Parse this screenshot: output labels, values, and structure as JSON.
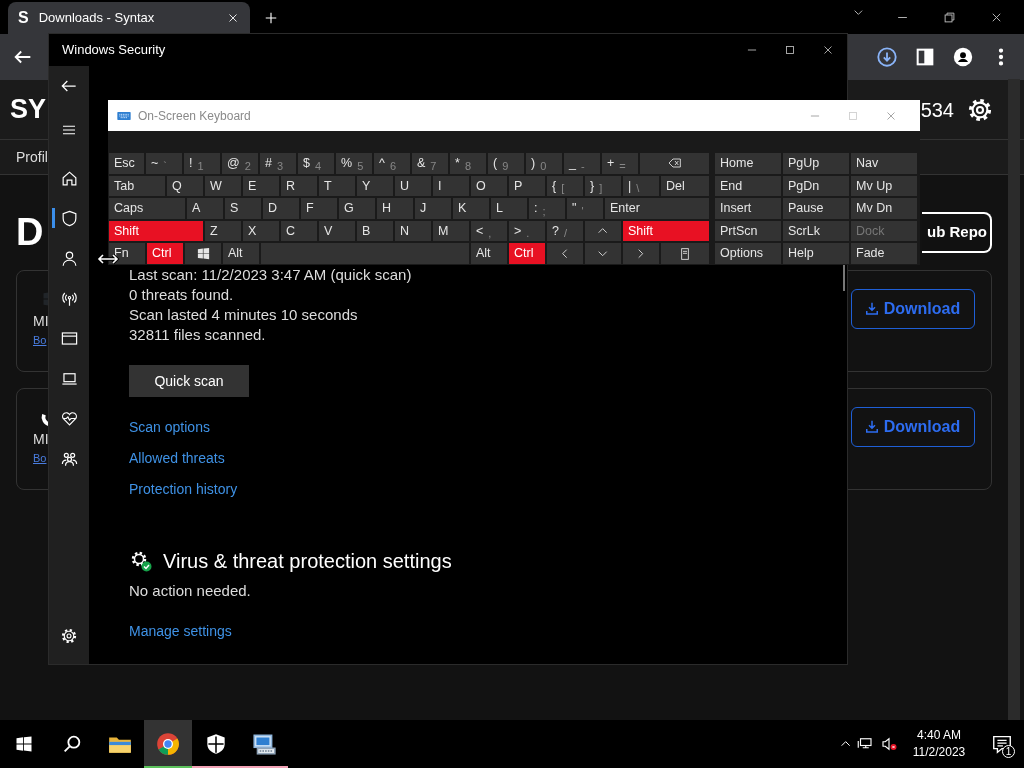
{
  "browser": {
    "tab": {
      "favicon": "S",
      "title": "Downloads - Syntax"
    },
    "page": {
      "brand": "SY",
      "star_count": "534",
      "nav_link": "Profil",
      "heading": "D",
      "repo_button": "ub Repo",
      "cards": [
        {
          "kind": "windows",
          "name": "MI",
          "link": "Bo",
          "button": "Download"
        },
        {
          "kind": "ring",
          "name": "MI",
          "link": "Bo",
          "button": "Download"
        }
      ]
    }
  },
  "security": {
    "title": "Windows Security",
    "nav": [
      {
        "kind": "home",
        "selected": false
      },
      {
        "kind": "shield",
        "selected": true
      },
      {
        "kind": "person",
        "selected": false
      },
      {
        "kind": "wireless",
        "selected": false
      },
      {
        "kind": "window",
        "selected": false
      },
      {
        "kind": "laptop",
        "selected": false
      },
      {
        "kind": "heart",
        "selected": false
      },
      {
        "kind": "family",
        "selected": false
      }
    ],
    "scan_info": [
      "Last scan: 11/2/2023 3:47 AM (quick scan)",
      "0 threats found.",
      "Scan lasted 4 minutes 10 seconds",
      "32811 files scanned."
    ],
    "scan_button": "Quick scan",
    "links": [
      "Scan options",
      "Allowed threats",
      "Protection history"
    ],
    "settings": {
      "heading": "Virus & threat protection settings",
      "status": "No action needed.",
      "link": "Manage settings"
    }
  },
  "keyboard": {
    "title": "On-Screen Keyboard",
    "rows": [
      {
        "keys": [
          {
            "kind": "key",
            "label": "Esc",
            "pressed": false
          },
          {
            "kind": "key",
            "label": "~",
            "sub": "`",
            "pressed": false
          },
          {
            "kind": "key",
            "label": "!",
            "sub": "1",
            "pressed": false
          },
          {
            "kind": "key",
            "label": "@",
            "sub": "2",
            "pressed": false
          },
          {
            "kind": "key",
            "label": "#",
            "sub": "3",
            "pressed": false
          },
          {
            "kind": "key",
            "label": "$",
            "sub": "4",
            "pressed": false
          },
          {
            "kind": "key",
            "label": "%",
            "sub": "5",
            "pressed": false
          },
          {
            "kind": "key",
            "label": "^",
            "sub": "6",
            "pressed": false
          },
          {
            "kind": "key",
            "label": "&",
            "sub": "7",
            "pressed": false
          },
          {
            "kind": "key",
            "label": "*",
            "sub": "8",
            "pressed": false
          },
          {
            "kind": "key",
            "label": "(",
            "sub": "9",
            "pressed": false
          },
          {
            "kind": "key",
            "label": ")",
            "sub": "0",
            "pressed": false
          },
          {
            "kind": "key",
            "label": "_",
            "sub": "-",
            "pressed": false
          },
          {
            "kind": "key",
            "label": "+",
            "sub": "=",
            "pressed": false
          },
          {
            "kind": "backspace",
            "pressed": false
          }
        ]
      },
      {
        "keys": [
          {
            "kind": "key",
            "label": "Tab",
            "pressed": false
          },
          {
            "kind": "key",
            "label": "Q",
            "pressed": false
          },
          {
            "kind": "key",
            "label": "W",
            "pressed": false
          },
          {
            "kind": "key",
            "label": "E",
            "pressed": false
          },
          {
            "kind": "key",
            "label": "R",
            "pressed": false
          },
          {
            "kind": "key",
            "label": "T",
            "pressed": false
          },
          {
            "kind": "key",
            "label": "Y",
            "pressed": false
          },
          {
            "kind": "key",
            "label": "U",
            "pressed": false
          },
          {
            "kind": "key",
            "label": "I",
            "pressed": false
          },
          {
            "kind": "key",
            "label": "O",
            "pressed": false
          },
          {
            "kind": "key",
            "label": "P",
            "pressed": false
          },
          {
            "kind": "key",
            "label": "{",
            "sub": "[",
            "pressed": false
          },
          {
            "kind": "key",
            "label": "}",
            "sub": "]",
            "pressed": false
          },
          {
            "kind": "key",
            "label": "|",
            "sub": "\\",
            "pressed": false
          },
          {
            "kind": "key",
            "label": "Del",
            "pressed": false
          }
        ]
      },
      {
        "keys": [
          {
            "kind": "key",
            "label": "Caps",
            "pressed": false
          },
          {
            "kind": "key",
            "label": "A",
            "pressed": false
          },
          {
            "kind": "key",
            "label": "S",
            "pressed": false
          },
          {
            "kind": "key",
            "label": "D",
            "pressed": false
          },
          {
            "kind": "key",
            "label": "F",
            "pressed": false
          },
          {
            "kind": "key",
            "label": "G",
            "pressed": false
          },
          {
            "kind": "key",
            "label": "H",
            "pressed": false
          },
          {
            "kind": "key",
            "label": "J",
            "pressed": false
          },
          {
            "kind": "key",
            "label": "K",
            "pressed": false
          },
          {
            "kind": "key",
            "label": "L",
            "pressed": false
          },
          {
            "kind": "key",
            "label": ":",
            "sub": ";",
            "pressed": false
          },
          {
            "kind": "key",
            "label": "\"",
            "sub": "'",
            "pressed": false
          },
          {
            "kind": "key",
            "label": "Enter",
            "pressed": false
          }
        ]
      },
      {
        "keys": [
          {
            "kind": "key",
            "label": "Shift",
            "pressed": true
          },
          {
            "kind": "key",
            "label": "Z",
            "pressed": false
          },
          {
            "kind": "key",
            "label": "X",
            "pressed": false
          },
          {
            "kind": "key",
            "label": "C",
            "pressed": false
          },
          {
            "kind": "key",
            "label": "V",
            "pressed": false
          },
          {
            "kind": "key",
            "label": "B",
            "pressed": false
          },
          {
            "kind": "key",
            "label": "N",
            "pressed": false
          },
          {
            "kind": "key",
            "label": "M",
            "pressed": false
          },
          {
            "kind": "key",
            "label": "<",
            "sub": ",",
            "pressed": false
          },
          {
            "kind": "key",
            "label": ">",
            "sub": ".",
            "pressed": false
          },
          {
            "kind": "key",
            "label": "?",
            "sub": "/",
            "pressed": false
          },
          {
            "kind": "up",
            "pressed": false
          },
          {
            "kind": "key",
            "label": "Shift",
            "pressed": true
          }
        ]
      },
      {
        "keys": [
          {
            "kind": "key",
            "label": "Fn",
            "pressed": false
          },
          {
            "kind": "key",
            "label": "Ctrl",
            "pressed": true
          },
          {
            "kind": "windows",
            "pressed": false
          },
          {
            "kind": "key",
            "label": "Alt",
            "pressed": false
          },
          {
            "kind": "space",
            "pressed": false
          },
          {
            "kind": "key",
            "label": "Alt",
            "pressed": false
          },
          {
            "kind": "key",
            "label": "Ctrl",
            "pressed": true
          },
          {
            "kind": "left",
            "pressed": false
          },
          {
            "kind": "down",
            "pressed": false
          },
          {
            "kind": "right",
            "pressed": false
          },
          {
            "kind": "menu",
            "pressed": false
          }
        ]
      }
    ],
    "nav_rows": [
      {
        "keys": [
          {
            "label": "Home",
            "disabled": false
          },
          {
            "label": "PgUp",
            "disabled": false
          },
          {
            "label": "Nav",
            "disabled": false
          }
        ]
      },
      {
        "keys": [
          {
            "label": "End",
            "disabled": false
          },
          {
            "label": "PgDn",
            "disabled": false
          },
          {
            "label": "Mv Up",
            "disabled": false
          }
        ]
      },
      {
        "keys": [
          {
            "label": "Insert",
            "disabled": false
          },
          {
            "label": "Pause",
            "disabled": false
          },
          {
            "label": "Mv Dn",
            "disabled": false
          }
        ]
      },
      {
        "keys": [
          {
            "label": "PrtScn",
            "disabled": false
          },
          {
            "label": "ScrLk",
            "disabled": false
          },
          {
            "label": "Dock",
            "disabled": true
          }
        ]
      },
      {
        "keys": [
          {
            "label": "Options",
            "disabled": false
          },
          {
            "label": "Help",
            "disabled": false
          },
          {
            "label": "Fade",
            "disabled": false
          }
        ]
      }
    ]
  },
  "taskbar": {
    "apps": [
      {
        "kind": "folder",
        "active": false
      },
      {
        "kind": "browser",
        "active": true,
        "color": "#5cc25c"
      },
      {
        "kind": "shield",
        "active": false,
        "color": "#f2a3b6"
      },
      {
        "kind": "keyboard",
        "active": false,
        "color": "#f2a3b6"
      }
    ],
    "clock": {
      "time": "4:40 AM",
      "date": "11/2/2023"
    },
    "notifications": "1"
  }
}
